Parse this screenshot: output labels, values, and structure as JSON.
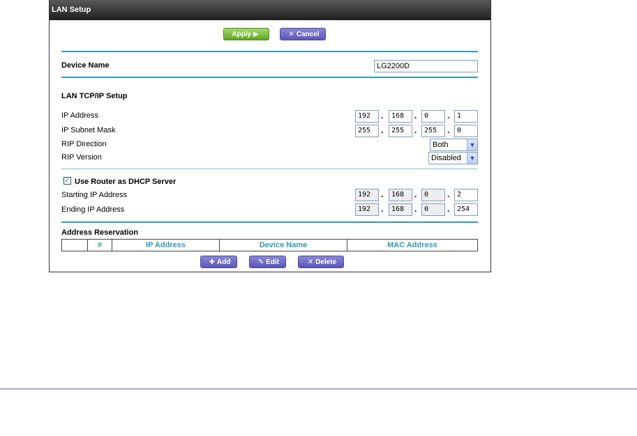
{
  "window": {
    "title": "LAN Setup"
  },
  "actions": {
    "apply": "Apply",
    "cancel": "Cancel"
  },
  "device": {
    "label": "Device Name",
    "value": "LG2200D"
  },
  "tcpip": {
    "heading": "LAN TCP/IP Setup",
    "ip_address": {
      "label": "IP Address",
      "octets": [
        "192",
        "168",
        "0",
        "1"
      ]
    },
    "subnet_mask": {
      "label": "IP Subnet Mask",
      "octets": [
        "255",
        "255",
        "255",
        "0"
      ]
    },
    "rip_direction": {
      "label": "RIP Direction",
      "value": "Both"
    },
    "rip_version": {
      "label": "RIP Version",
      "value": "Disabled"
    }
  },
  "dhcp": {
    "checkbox_label": "Use Router as DHCP Server",
    "checked": true,
    "start": {
      "label": "Starting IP Address",
      "octets": [
        "192",
        "168",
        "0",
        "2"
      ]
    },
    "end": {
      "label": "Ending IP Address",
      "octets": [
        "192",
        "168",
        "0",
        "254"
      ]
    }
  },
  "reservation": {
    "heading": "Address Reservation",
    "columns": [
      "",
      "#",
      "IP Address",
      "Device Name",
      "MAC Address"
    ],
    "buttons": {
      "add": "Add",
      "edit": "Edit",
      "delete": "Delete"
    }
  },
  "colors": {
    "accent": "#2f98b9",
    "apply_green": "#62a32a",
    "button_purple": "#5b56b3"
  }
}
